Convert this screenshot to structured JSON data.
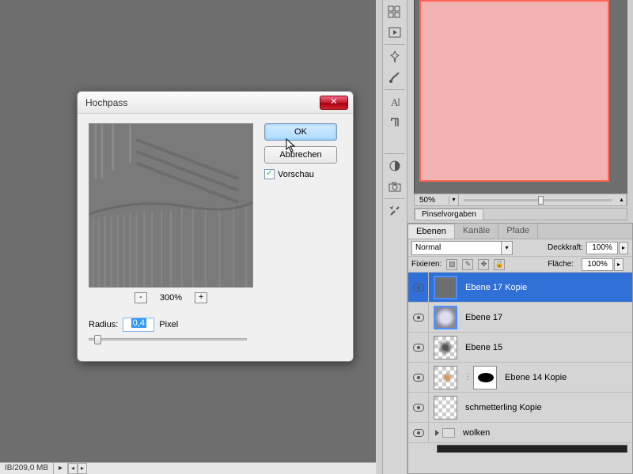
{
  "dialog": {
    "title": "Hochpass",
    "ok": "OK",
    "cancel": "Abbrechen",
    "preview_label": "Vorschau",
    "zoom_out": "-",
    "zoom_in": "+",
    "zoom_value": "300%",
    "radius_label": "Radius:",
    "radius_value": "0,4",
    "radius_unit": "Pixel",
    "close_glyph": "✕"
  },
  "status": {
    "memory": "IB/209,0 MB"
  },
  "subcanvas": {
    "zoom": "50%"
  },
  "brush_panel": {
    "tab": "Pinselvorgaben"
  },
  "layers_panel": {
    "tabs": {
      "ebenen": "Ebenen",
      "kanaele": "Kanäle",
      "pfade": "Pfade"
    },
    "mode": "Normal",
    "opacity_label": "Deckkraft:",
    "opacity_value": "100%",
    "lock_label": "Fixieren:",
    "fill_label": "Fläche:",
    "fill_value": "100%",
    "layers": [
      {
        "name": "Ebene 17 Kopie"
      },
      {
        "name": "Ebene 17"
      },
      {
        "name": "Ebene 15"
      },
      {
        "name": "Ebene 14 Kopie"
      },
      {
        "name": "schmetterling Kopie"
      },
      {
        "name": "wolken"
      }
    ]
  }
}
